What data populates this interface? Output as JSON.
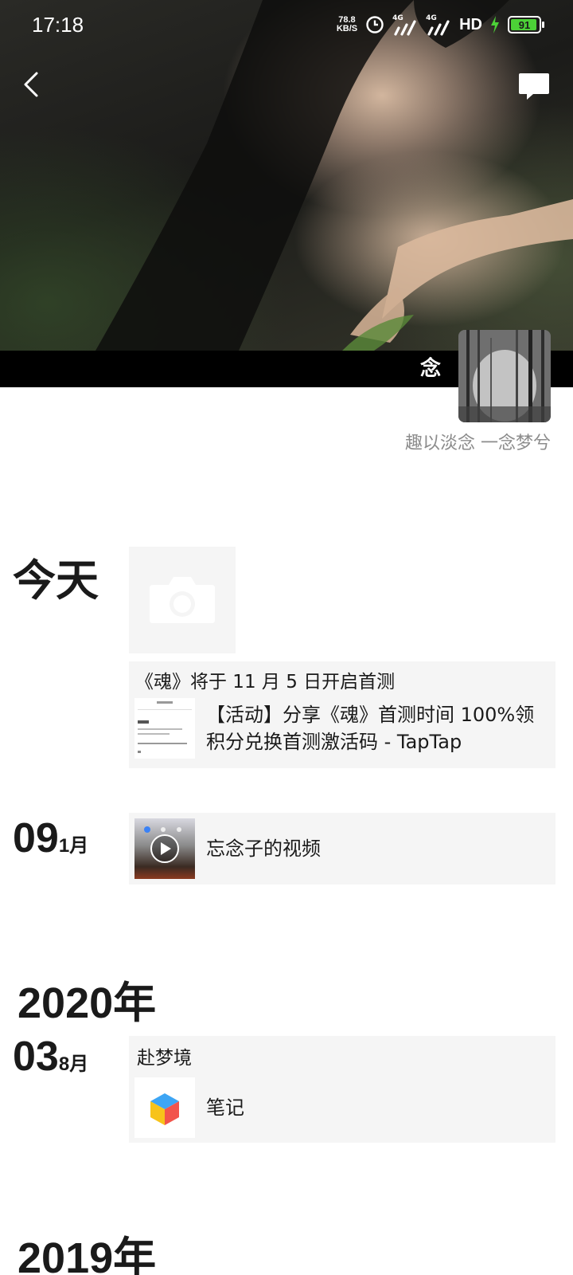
{
  "status_bar": {
    "time": "17:18",
    "net_speed_value": "78.8",
    "net_speed_unit": "KB/S",
    "signal_1": "4G",
    "signal_2": "4G",
    "hd": "HD",
    "battery": "91"
  },
  "profile": {
    "nickname": "念",
    "signature": "趣以淡念 一念梦兮"
  },
  "timeline": {
    "today_label": "今天",
    "today_link_card": {
      "title": "《魂》将于 11 月 5 日开启首测",
      "link_text": "【活动】分享《魂》首测时间 100%领积分兑换首测激活码 - TapTap"
    },
    "entry_0901": {
      "day": "09",
      "month": "1月",
      "text": "忘念子的视频"
    },
    "year_2020": "2020年",
    "entry_0308": {
      "day": "03",
      "month": "8月",
      "title": "赴梦境",
      "text": "笔记"
    },
    "year_2019": "2019年"
  }
}
